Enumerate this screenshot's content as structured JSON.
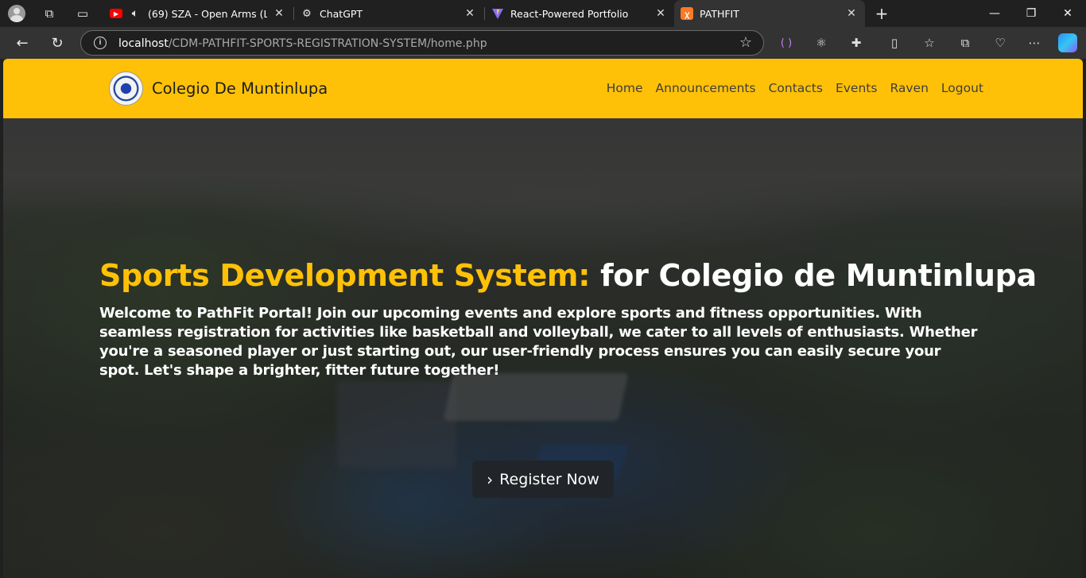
{
  "browser": {
    "tabs": [
      {
        "title": "(69) SZA - Open Arms (Lyrics",
        "favicon": "youtube-icon",
        "audio": true
      },
      {
        "title": "ChatGPT",
        "favicon": "chatgpt-icon"
      },
      {
        "title": "React-Powered Portfolio",
        "favicon": "vite-icon"
      },
      {
        "title": "PATHFIT",
        "favicon": "xampp-icon",
        "active": true
      }
    ],
    "url_host": "localhost",
    "url_path": "/CDM-PATHFIT-SPORTS-REGISTRATION-SYSTEM/home.php"
  },
  "site": {
    "brand": "Colegio De Muntinlupa",
    "nav": [
      "Home",
      "Announcements",
      "Contacts",
      "Events",
      "Raven",
      "Logout"
    ],
    "hero": {
      "title_accent": "Sports Development System:",
      "title_rest": "for Colegio de Muntinlupa",
      "text": "Welcome to PathFit Portal! Join our upcoming events and explore sports and fitness opportunities. With seamless registration for activities like basketball and volleyball, we cater to all levels of enthusiasts. Whether you're a seasoned player or just starting out, our user-friendly process ensures you can easily secure your spot. Let's shape a brighter, fitter future together!",
      "button": "Register Now"
    }
  },
  "colors": {
    "navbar": "#ffc107",
    "accent": "#ffc107",
    "button": "#212529"
  }
}
